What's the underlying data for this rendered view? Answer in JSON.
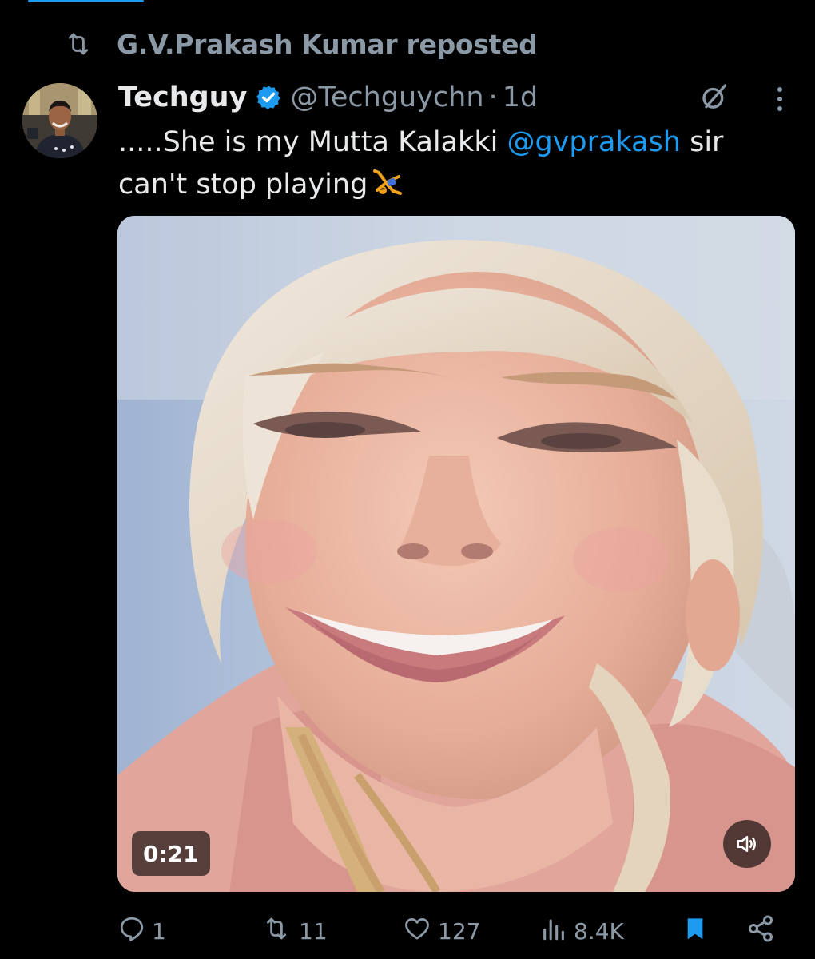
{
  "repost": {
    "label": "G.V.Prakash Kumar reposted"
  },
  "post": {
    "display_name": "Techguy",
    "handle": "@Techguychn",
    "separator": "·",
    "time": "1d",
    "text_before": ".....She is my Mutta Kalakki ",
    "mention": "@gvprakash",
    "text_after": " sir can't stop playing",
    "emoji": "person-cartwheeling"
  },
  "media": {
    "duration": "0:21",
    "volume_icon": "speaker-icon"
  },
  "actions": {
    "replies": "1",
    "reposts": "11",
    "likes": "127",
    "views": "8.4K"
  },
  "colors": {
    "background": "#000000",
    "text": "#e7e9ea",
    "muted": "#8b98a5",
    "accent": "#1d9bf0"
  }
}
